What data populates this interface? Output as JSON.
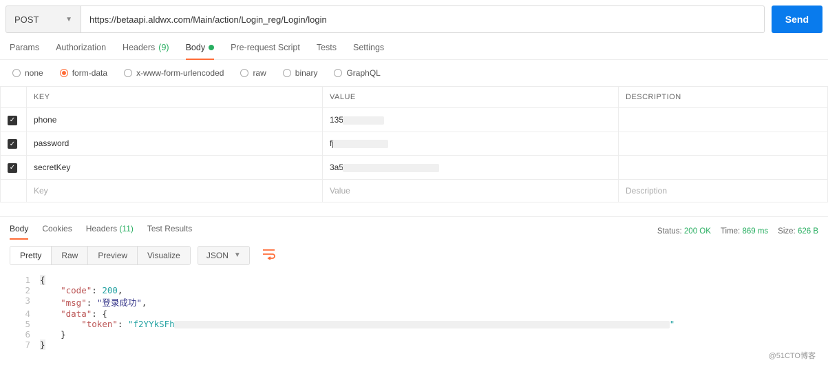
{
  "request": {
    "method": "POST",
    "url": "https://betaapi.aldwx.com/Main/action/Login_reg/Login/login",
    "send_label": "Send"
  },
  "req_tabs": {
    "params": "Params",
    "authorization": "Authorization",
    "headers_label": "Headers",
    "headers_count": "(9)",
    "body": "Body",
    "prerequest": "Pre-request Script",
    "tests": "Tests",
    "settings": "Settings"
  },
  "body_types": {
    "none": "none",
    "formdata": "form-data",
    "urlencoded": "x-www-form-urlencoded",
    "raw": "raw",
    "binary": "binary",
    "graphql": "GraphQL"
  },
  "table": {
    "headers": {
      "key": "KEY",
      "value": "VALUE",
      "description": "DESCRIPTION"
    },
    "rows": [
      {
        "key": "phone",
        "value": "135"
      },
      {
        "key": "password",
        "value": "fj"
      },
      {
        "key": "secretKey",
        "value": "3a5"
      }
    ],
    "placeholders": {
      "key": "Key",
      "value": "Value",
      "description": "Description"
    }
  },
  "resp_tabs": {
    "body": "Body",
    "cookies": "Cookies",
    "headers_label": "Headers",
    "headers_count": "(11)",
    "testresults": "Test Results"
  },
  "resp_stats": {
    "status_label": "Status:",
    "status_value": "200 OK",
    "time_label": "Time:",
    "time_value": "869 ms",
    "size_label": "Size:",
    "size_value": "626 B"
  },
  "viewer": {
    "pretty": "Pretty",
    "raw": "Raw",
    "preview": "Preview",
    "visualize": "Visualize",
    "format": "JSON"
  },
  "response_body": {
    "l1": "{",
    "l2_key": "\"code\"",
    "l2_colon": ": ",
    "l2_val": "200",
    "l2_end": ",",
    "l3_key": "\"msg\"",
    "l3_colon": ": ",
    "l3_val": "\"登录成功\"",
    "l3_end": ",",
    "l4_key": "\"data\"",
    "l4_colon": ": {",
    "l5_key": "\"token\"",
    "l5_colon": ": ",
    "l5_val": "\"f2YYkSFh",
    "l5_end": "\"",
    "l6": "}",
    "l7": "}"
  },
  "watermark": "@51CTO博客"
}
